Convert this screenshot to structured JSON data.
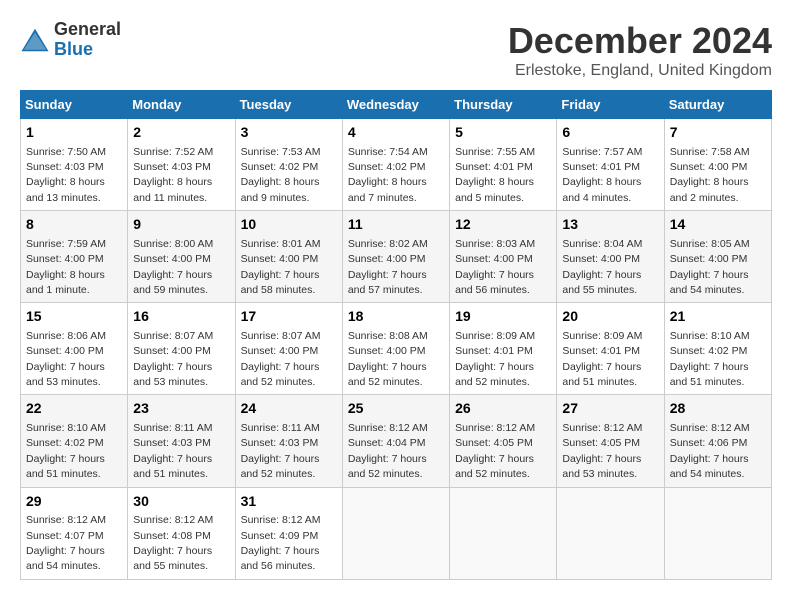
{
  "logo": {
    "general": "General",
    "blue": "Blue"
  },
  "header": {
    "month": "December 2024",
    "location": "Erlestoke, England, United Kingdom"
  },
  "weekdays": [
    "Sunday",
    "Monday",
    "Tuesday",
    "Wednesday",
    "Thursday",
    "Friday",
    "Saturday"
  ],
  "weeks": [
    [
      {
        "day": "1",
        "sunrise": "7:50 AM",
        "sunset": "4:03 PM",
        "daylight": "8 hours and 13 minutes."
      },
      {
        "day": "2",
        "sunrise": "7:52 AM",
        "sunset": "4:03 PM",
        "daylight": "8 hours and 11 minutes."
      },
      {
        "day": "3",
        "sunrise": "7:53 AM",
        "sunset": "4:02 PM",
        "daylight": "8 hours and 9 minutes."
      },
      {
        "day": "4",
        "sunrise": "7:54 AM",
        "sunset": "4:02 PM",
        "daylight": "8 hours and 7 minutes."
      },
      {
        "day": "5",
        "sunrise": "7:55 AM",
        "sunset": "4:01 PM",
        "daylight": "8 hours and 5 minutes."
      },
      {
        "day": "6",
        "sunrise": "7:57 AM",
        "sunset": "4:01 PM",
        "daylight": "8 hours and 4 minutes."
      },
      {
        "day": "7",
        "sunrise": "7:58 AM",
        "sunset": "4:00 PM",
        "daylight": "8 hours and 2 minutes."
      }
    ],
    [
      {
        "day": "8",
        "sunrise": "7:59 AM",
        "sunset": "4:00 PM",
        "daylight": "8 hours and 1 minute."
      },
      {
        "day": "9",
        "sunrise": "8:00 AM",
        "sunset": "4:00 PM",
        "daylight": "7 hours and 59 minutes."
      },
      {
        "day": "10",
        "sunrise": "8:01 AM",
        "sunset": "4:00 PM",
        "daylight": "7 hours and 58 minutes."
      },
      {
        "day": "11",
        "sunrise": "8:02 AM",
        "sunset": "4:00 PM",
        "daylight": "7 hours and 57 minutes."
      },
      {
        "day": "12",
        "sunrise": "8:03 AM",
        "sunset": "4:00 PM",
        "daylight": "7 hours and 56 minutes."
      },
      {
        "day": "13",
        "sunrise": "8:04 AM",
        "sunset": "4:00 PM",
        "daylight": "7 hours and 55 minutes."
      },
      {
        "day": "14",
        "sunrise": "8:05 AM",
        "sunset": "4:00 PM",
        "daylight": "7 hours and 54 minutes."
      }
    ],
    [
      {
        "day": "15",
        "sunrise": "8:06 AM",
        "sunset": "4:00 PM",
        "daylight": "7 hours and 53 minutes."
      },
      {
        "day": "16",
        "sunrise": "8:07 AM",
        "sunset": "4:00 PM",
        "daylight": "7 hours and 53 minutes."
      },
      {
        "day": "17",
        "sunrise": "8:07 AM",
        "sunset": "4:00 PM",
        "daylight": "7 hours and 52 minutes."
      },
      {
        "day": "18",
        "sunrise": "8:08 AM",
        "sunset": "4:00 PM",
        "daylight": "7 hours and 52 minutes."
      },
      {
        "day": "19",
        "sunrise": "8:09 AM",
        "sunset": "4:01 PM",
        "daylight": "7 hours and 52 minutes."
      },
      {
        "day": "20",
        "sunrise": "8:09 AM",
        "sunset": "4:01 PM",
        "daylight": "7 hours and 51 minutes."
      },
      {
        "day": "21",
        "sunrise": "8:10 AM",
        "sunset": "4:02 PM",
        "daylight": "7 hours and 51 minutes."
      }
    ],
    [
      {
        "day": "22",
        "sunrise": "8:10 AM",
        "sunset": "4:02 PM",
        "daylight": "7 hours and 51 minutes."
      },
      {
        "day": "23",
        "sunrise": "8:11 AM",
        "sunset": "4:03 PM",
        "daylight": "7 hours and 51 minutes."
      },
      {
        "day": "24",
        "sunrise": "8:11 AM",
        "sunset": "4:03 PM",
        "daylight": "7 hours and 52 minutes."
      },
      {
        "day": "25",
        "sunrise": "8:12 AM",
        "sunset": "4:04 PM",
        "daylight": "7 hours and 52 minutes."
      },
      {
        "day": "26",
        "sunrise": "8:12 AM",
        "sunset": "4:05 PM",
        "daylight": "7 hours and 52 minutes."
      },
      {
        "day": "27",
        "sunrise": "8:12 AM",
        "sunset": "4:05 PM",
        "daylight": "7 hours and 53 minutes."
      },
      {
        "day": "28",
        "sunrise": "8:12 AM",
        "sunset": "4:06 PM",
        "daylight": "7 hours and 54 minutes."
      }
    ],
    [
      {
        "day": "29",
        "sunrise": "8:12 AM",
        "sunset": "4:07 PM",
        "daylight": "7 hours and 54 minutes."
      },
      {
        "day": "30",
        "sunrise": "8:12 AM",
        "sunset": "4:08 PM",
        "daylight": "7 hours and 55 minutes."
      },
      {
        "day": "31",
        "sunrise": "8:12 AM",
        "sunset": "4:09 PM",
        "daylight": "7 hours and 56 minutes."
      },
      null,
      null,
      null,
      null
    ]
  ],
  "labels": {
    "sunrise": "Sunrise: ",
    "sunset": "Sunset: ",
    "daylight": "Daylight: "
  }
}
